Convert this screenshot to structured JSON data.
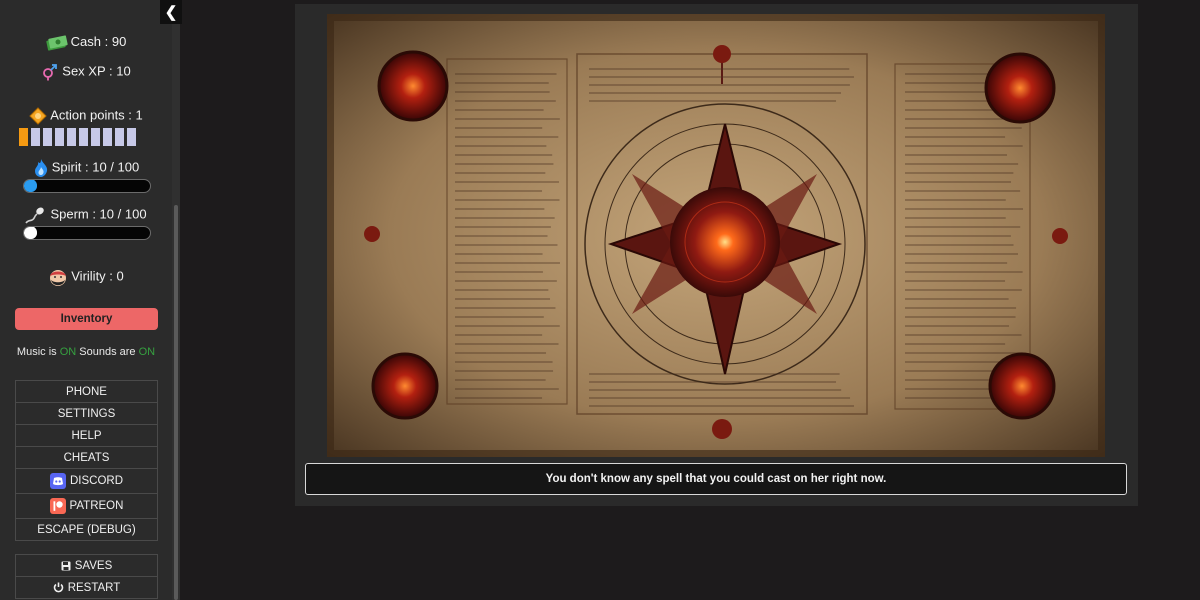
{
  "sidebar": {
    "cash": {
      "label": "Cash : 90",
      "icon": "cash-icon"
    },
    "sex_xp": {
      "label": "Sex XP : 10",
      "icon": "gender-icon"
    },
    "action_points": {
      "label": "Action points : 1",
      "icon": "action-points-icon",
      "filled": 1,
      "total": 10
    },
    "spirit": {
      "label": "Spirit : 10 / 100",
      "icon": "flame-icon",
      "value": 10,
      "max": 100,
      "color": "#2a9cf0"
    },
    "sperm": {
      "label": "Sperm : 10 / 100",
      "icon": "sperm-icon",
      "value": 10,
      "max": 100,
      "color": "#ffffff"
    },
    "virility": {
      "label": "Virility : 0",
      "icon": "face-icon"
    },
    "inventory_label": "Inventory",
    "audio": {
      "music_prefix": "Music is ",
      "music_state": "ON",
      "sounds_prefix": " Sounds are ",
      "sounds_state": "ON"
    },
    "menu": {
      "phone": "PHONE",
      "settings": "SETTINGS",
      "help": "HELP",
      "cheats": "CHEATS",
      "discord": "DISCORD",
      "patreon": "PATREON",
      "escape": "ESCAPE (DEBUG)"
    },
    "menu2": {
      "saves": "SAVES",
      "restart": "RESTART"
    }
  },
  "colors": {
    "accent_inventory": "#ed6767",
    "on": "#36a040",
    "action_point": "#f59a12",
    "discord": "#5865f2",
    "patreon": "#f96854"
  },
  "main": {
    "scene_icon": "grimoire-pentagram-image",
    "dialogue": "You don't know any spell that you could cast on her right now."
  }
}
